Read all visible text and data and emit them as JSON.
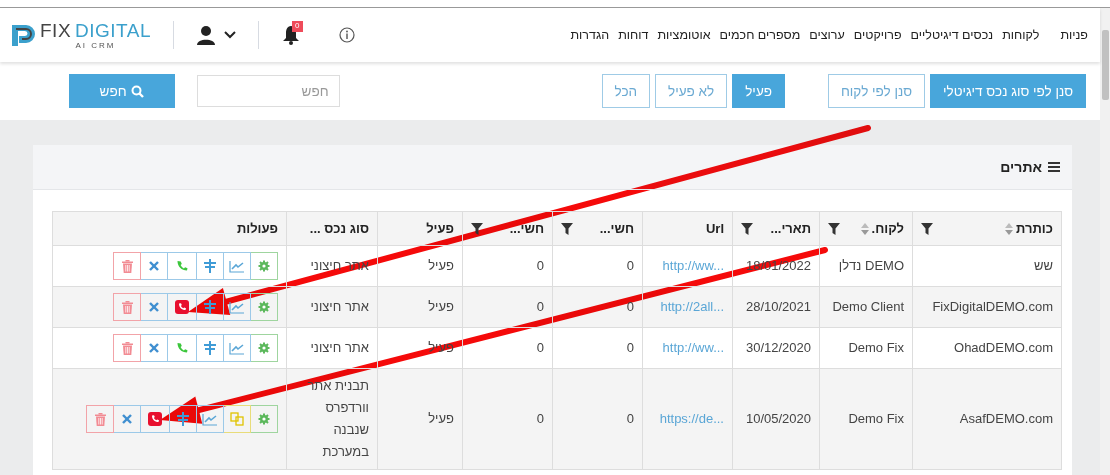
{
  "header": {
    "nav": [
      {
        "label": "פניות"
      },
      {
        "label": "לקוחות"
      },
      {
        "label": "נכסים דיגיטליים"
      },
      {
        "label": "פרויקטים"
      },
      {
        "label": "ערוצים"
      },
      {
        "label": "מספרים חכמים"
      },
      {
        "label": "אוטומציות"
      },
      {
        "label": "דוחות"
      },
      {
        "label": "הגדרות"
      }
    ],
    "logo": {
      "primary": "FIX",
      "secondary": "DIGITAL",
      "tagline": "AI CRM"
    },
    "notifications": {
      "count": "0"
    }
  },
  "toolbar": {
    "filters": [
      {
        "label": "סנן לפי סוג נכס דיגיטלי",
        "selected": true
      },
      {
        "label": "סנן לפי לקוח",
        "selected": false
      }
    ],
    "status_tabs": [
      {
        "label": "פעיל",
        "selected": true
      },
      {
        "label": "לא פעיל",
        "selected": false
      },
      {
        "label": "הכל",
        "selected": false
      }
    ],
    "search": {
      "placeholder": "חפש"
    },
    "search_button": "חפש"
  },
  "card": {
    "title": "אתרים"
  },
  "table": {
    "columns": [
      {
        "label": "כותרת",
        "kind": "text",
        "sort": true,
        "filter": true
      },
      {
        "label": "לקוח.",
        "kind": "text",
        "sort": true,
        "filter": true
      },
      {
        "label": "תארי...",
        "kind": "text",
        "sort": false,
        "filter": true
      },
      {
        "label": "Url",
        "kind": "link",
        "sort": false,
        "filter": false
      },
      {
        "label": "חשי...",
        "kind": "text",
        "sort": false,
        "filter": true
      },
      {
        "label": "חשי...",
        "kind": "text",
        "sort": false,
        "filter": true
      },
      {
        "label": "פעיל",
        "kind": "text",
        "sort": false,
        "filter": false
      },
      {
        "label": "סוג נכס ...",
        "kind": "text",
        "sort": false,
        "filter": false
      },
      {
        "label": "פעולות",
        "kind": "actions",
        "sort": false,
        "filter": false
      }
    ],
    "rows": [
      {
        "cells": [
          "שש",
          "DEMO נדלן",
          "18/01/2022",
          "http://ww...",
          "0",
          "0",
          "פעיל",
          "אתר חיצוני"
        ],
        "actions": [
          {
            "kind": "settings"
          },
          {
            "kind": "chart"
          },
          {
            "kind": "columns"
          },
          {
            "kind": "phone",
            "active": false
          },
          {
            "kind": "close"
          },
          {
            "kind": "delete"
          }
        ]
      },
      {
        "cells": [
          "FixDigitalDEMO.com",
          "Demo Client",
          "28/10/2021",
          "http://2all...",
          "0",
          "0",
          "פעיל",
          "אתר חיצוני"
        ],
        "actions": [
          {
            "kind": "settings"
          },
          {
            "kind": "chart"
          },
          {
            "kind": "columns"
          },
          {
            "kind": "phone",
            "active": true
          },
          {
            "kind": "close"
          },
          {
            "kind": "delete"
          }
        ]
      },
      {
        "cells": [
          "OhadDEMO.com",
          "Demo Fix",
          "30/12/2020",
          "http://ww...",
          "0",
          "0",
          "פעיל",
          "אתר חיצוני"
        ],
        "actions": [
          {
            "kind": "settings"
          },
          {
            "kind": "chart"
          },
          {
            "kind": "columns"
          },
          {
            "kind": "phone",
            "active": false
          },
          {
            "kind": "close"
          },
          {
            "kind": "delete"
          }
        ]
      },
      {
        "cells": [
          "AsafDEMO.com",
          "Demo Fix",
          "10/05/2020",
          "https://de...",
          "0",
          "0",
          "פעיל",
          "תבנית אתר וורדפרס שנבנה במערכת"
        ],
        "actions": [
          {
            "kind": "settings"
          },
          {
            "kind": "copy"
          },
          {
            "kind": "chart"
          },
          {
            "kind": "columns"
          },
          {
            "kind": "phone",
            "active": true
          },
          {
            "kind": "close"
          },
          {
            "kind": "delete"
          }
        ]
      }
    ]
  },
  "annotations": [
    {
      "kind": "arrow"
    },
    {
      "kind": "arrow"
    }
  ]
}
